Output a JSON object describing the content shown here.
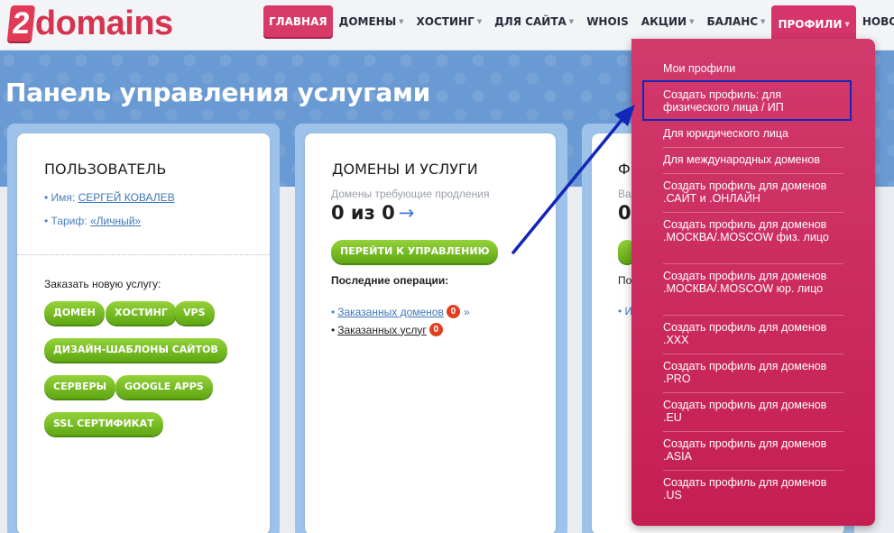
{
  "logo": {
    "number": "2",
    "text": "domains"
  },
  "nav": [
    {
      "label": "ГЛАВНАЯ",
      "caret": false,
      "state": "active"
    },
    {
      "label": "ДОМЕНЫ",
      "caret": true,
      "state": ""
    },
    {
      "label": "ХОСТИНГ",
      "caret": true,
      "state": ""
    },
    {
      "label": "ДЛЯ САЙТА",
      "caret": true,
      "state": ""
    },
    {
      "label": "WHOIS",
      "caret": false,
      "state": ""
    },
    {
      "label": "АКЦИИ",
      "caret": true,
      "state": ""
    },
    {
      "label": "БАЛАНС",
      "caret": true,
      "state": ""
    },
    {
      "label": "ПРОФИЛИ",
      "caret": true,
      "state": "open"
    },
    {
      "label": "НОВОСТИ",
      "caret": false,
      "state": ""
    }
  ],
  "page_title": "Панель управления услугами",
  "user_card": {
    "title": "ПОЛЬЗОВАТЕЛЬ",
    "name_label": "• Имя:",
    "name_value": "СЕРГЕЙ КОВАЛЕВ",
    "tariff_label": "• Тариф:",
    "tariff_value": "«Личный»",
    "order_title": "Заказать новую услугу:",
    "services": [
      "ДОМЕН",
      "ХОСТИНГ",
      "VPS",
      "ДИЗАЙН-ШАБЛОНЫ САЙТОВ",
      "СЕРВЕРЫ",
      "GOOGLE APPS",
      "SSL СЕРТИФИКАТ"
    ]
  },
  "domains_card": {
    "title": "ДОМЕНЫ И УСЛУГИ",
    "renew_label": "Домены требующие продления",
    "renew_count": "0 из 0",
    "arrow": "→",
    "manage_button": "ПЕРЕЙТИ К УПРАВЛЕНИЮ",
    "recent_title": "Последние операции:",
    "ops": [
      {
        "label": "Заказанных доменов",
        "count": "0",
        "suffix": "»"
      },
      {
        "label": "Заказанных услуг",
        "count": "0",
        "suffix": ""
      }
    ]
  },
  "third_card": {
    "title_fragment": "Ф",
    "muted_fragment": "Ва",
    "num_fragment": "0",
    "recent_fragment": "По",
    "link_fragment": "• И"
  },
  "profiles_menu": [
    "Мои профили",
    "Создать профиль: для физического лица / ИП",
    "Для юридического лица",
    "Для международных доменов",
    "Создать профиль для доменов .САЙТ и .ОНЛАЙН",
    "Создать профиль для доменов .МОСКВА/.MOSCOW физ. лицо",
    "Создать профиль для доменов .МОСКВА/.MOSCOW юр. лицо",
    "Создать профиль для доменов .XXX",
    "Создать профиль для доменов .PRO",
    "Создать профиль для доменов .EU",
    "Создать профиль для доменов .ASIA",
    "Создать профиль для доменов .US"
  ],
  "colors": {
    "brand": "#d6334f",
    "menu_bg": "#c51e52",
    "pill_green": "#6fb51c",
    "annotation": "#1426b8"
  }
}
